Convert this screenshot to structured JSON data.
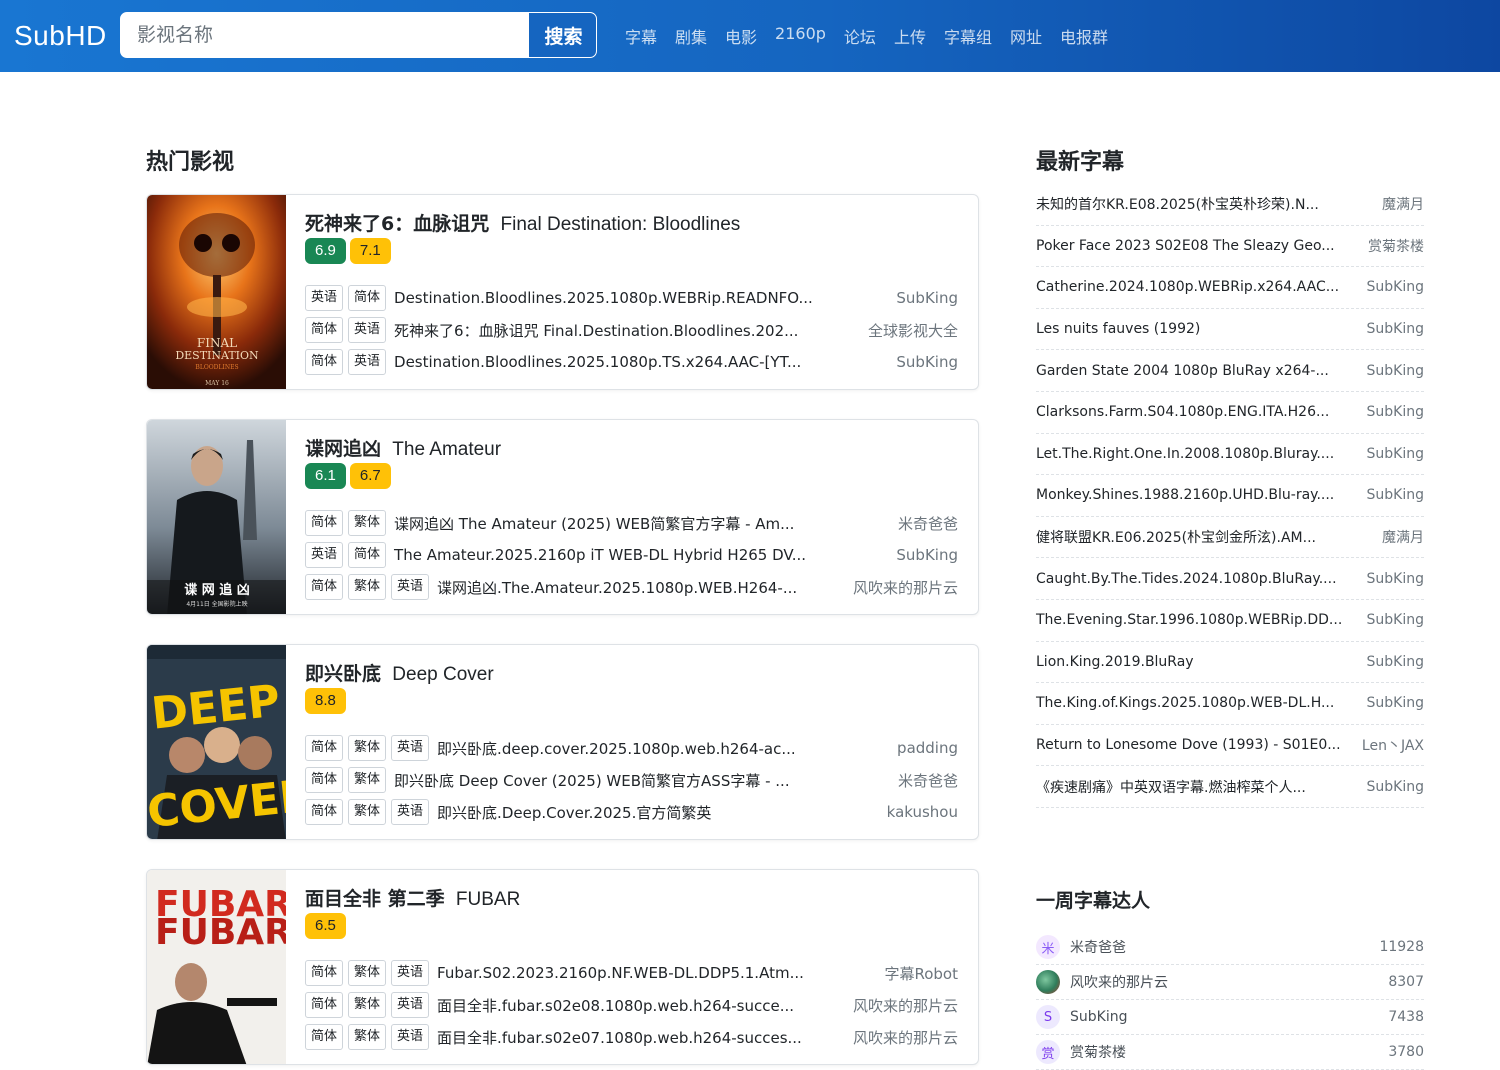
{
  "header": {
    "logo": "SubHD",
    "search_placeholder": "影视名称",
    "search_button": "搜索",
    "nav": [
      "字幕",
      "剧集",
      "电影",
      "2160p",
      "论坛",
      "上传",
      "字幕组",
      "网址",
      "电报群"
    ]
  },
  "hot": {
    "title": "热门影视",
    "movies": [
      {
        "title_cn": "死神来了6：血脉诅咒",
        "title_en": "Final Destination: Bloodlines",
        "ratings": [
          {
            "value": "6.9",
            "color": "green"
          },
          {
            "value": "7.1",
            "color": "yellow"
          }
        ],
        "poster": {
          "lines": [
            "FINAL",
            "DESTINATION",
            "BLOODLINES",
            "MAY 16"
          ],
          "icon": "poster-final-destination"
        },
        "subs": [
          {
            "tags": [
              "英语",
              "简体"
            ],
            "name": "Destination.Bloodlines.2025.1080p.WEBRip.READNFO...",
            "author": "SubKing"
          },
          {
            "tags": [
              "简体",
              "英语"
            ],
            "name": "死神来了6：血脉诅咒 Final.Destination.Bloodlines.202...",
            "author": "全球影视大全"
          },
          {
            "tags": [
              "简体",
              "英语"
            ],
            "name": "Destination.Bloodlines.2025.1080p.TS.x264.AAC-[YT...",
            "author": "SubKing"
          }
        ]
      },
      {
        "title_cn": "谍网追凶",
        "title_en": "The Amateur",
        "ratings": [
          {
            "value": "6.1",
            "color": "green"
          },
          {
            "value": "6.7",
            "color": "yellow"
          }
        ],
        "poster": {
          "lines": [
            "谍 网 追 凶",
            "4月11日 全国影院上映"
          ],
          "icon": "poster-the-amateur"
        },
        "subs": [
          {
            "tags": [
              "简体",
              "繁体"
            ],
            "name": "谍网追凶 The Amateur (2025) WEB简繁官方字幕 - Am...",
            "author": "米奇爸爸"
          },
          {
            "tags": [
              "英语",
              "简体"
            ],
            "name": "The Amateur.2025.2160p iT WEB-DL Hybrid H265 DV...",
            "author": "SubKing"
          },
          {
            "tags": [
              "简体",
              "繁体",
              "英语"
            ],
            "name": "谍网追凶.The.Amateur.2025.1080p.WEB.H264-...",
            "author": "风吹来的那片云"
          }
        ]
      },
      {
        "title_cn": "即兴卧底",
        "title_en": "Deep Cover",
        "ratings": [
          {
            "value": "8.8",
            "color": "yellow"
          }
        ],
        "poster": {
          "lines": [
            "DEEP",
            "COVER"
          ],
          "icon": "poster-deep-cover"
        },
        "subs": [
          {
            "tags": [
              "简体",
              "繁体",
              "英语"
            ],
            "name": "即兴卧底.deep.cover.2025.1080p.web.h264-ac...",
            "author": "padding"
          },
          {
            "tags": [
              "简体",
              "繁体"
            ],
            "name": "即兴卧底 Deep Cover (2025) WEB简繁官方ASS字幕 - ...",
            "author": "米奇爸爸"
          },
          {
            "tags": [
              "简体",
              "繁体",
              "英语"
            ],
            "name": "即兴卧底.Deep.Cover.2025.官方简繁英",
            "author": "kakushou"
          }
        ]
      },
      {
        "title_cn": "面目全非 第二季",
        "title_en": "FUBAR",
        "ratings": [
          {
            "value": "6.5",
            "color": "yellow"
          }
        ],
        "poster": {
          "lines": [
            "FUBAR",
            "FUBAR"
          ],
          "icon": "poster-fubar"
        },
        "subs": [
          {
            "tags": [
              "简体",
              "繁体",
              "英语"
            ],
            "name": "Fubar.S02.2023.2160p.NF.WEB-DL.DDP5.1.Atm...",
            "author": "字幕Robot"
          },
          {
            "tags": [
              "简体",
              "繁体",
              "英语"
            ],
            "name": "面目全非.fubar.s02e08.1080p.web.h264-succe...",
            "author": "风吹来的那片云"
          },
          {
            "tags": [
              "简体",
              "繁体",
              "英语"
            ],
            "name": "面目全非.fubar.s02e07.1080p.web.h264-succes...",
            "author": "风吹来的那片云"
          }
        ]
      }
    ]
  },
  "latest": {
    "title": "最新字幕",
    "items": [
      {
        "name": "未知的首尔KR.E08.2025(朴宝英朴珍荣).N...",
        "author": "魔满月"
      },
      {
        "name": "Poker Face 2023 S02E08 The Sleazy Geo...",
        "author": "赏菊茶楼"
      },
      {
        "name": "Catherine.2024.1080p.WEBRip.x264.AAC...",
        "author": "SubKing"
      },
      {
        "name": "Les nuits fauves (1992)",
        "author": "SubKing"
      },
      {
        "name": "Garden State 2004 1080p BluRay x264-...",
        "author": "SubKing"
      },
      {
        "name": "Clarksons.Farm.S04.1080p.ENG.ITA.H26...",
        "author": "SubKing"
      },
      {
        "name": "Let.The.Right.One.In.2008.1080p.Bluray....",
        "author": "SubKing"
      },
      {
        "name": "Monkey.Shines.1988.2160p.UHD.Blu-ray....",
        "author": "SubKing"
      },
      {
        "name": "健将联盟KR.E06.2025(朴宝剑金所泫).AM...",
        "author": "魔满月"
      },
      {
        "name": "Caught.By.The.Tides.2024.1080p.BluRay....",
        "author": "SubKing"
      },
      {
        "name": "The.Evening.Star.1996.1080p.WEBRip.DD...",
        "author": "SubKing"
      },
      {
        "name": "Lion.King.2019.BluRay",
        "author": "SubKing"
      },
      {
        "name": "The.King.of.Kings.2025.1080p.WEB-DL.H...",
        "author": "SubKing"
      },
      {
        "name": "Return to Lonesome Dove (1993) - S01E0...",
        "author": "Len丶JAX"
      },
      {
        "name": "《疾速剧痛》中英双语字幕.燃油榨菜个人...",
        "author": "SubKing"
      }
    ]
  },
  "weekly": {
    "title": "一周字幕达人",
    "users": [
      {
        "avatar": "米",
        "name": "米奇爸爸",
        "count": "11928",
        "bg": "#f3e8ff",
        "fg": "#8b5cf6"
      },
      {
        "avatar": "",
        "name": "风吹来的那片云",
        "count": "8307",
        "bg": "#2f7d5b",
        "fg": "#fff"
      },
      {
        "avatar": "S",
        "name": "SubKing",
        "count": "7438",
        "bg": "#ede9fe",
        "fg": "#7c3aed"
      },
      {
        "avatar": "赏",
        "name": "赏菊茶楼",
        "count": "3780",
        "bg": "#ede9fe",
        "fg": "#7c3aed"
      }
    ]
  }
}
